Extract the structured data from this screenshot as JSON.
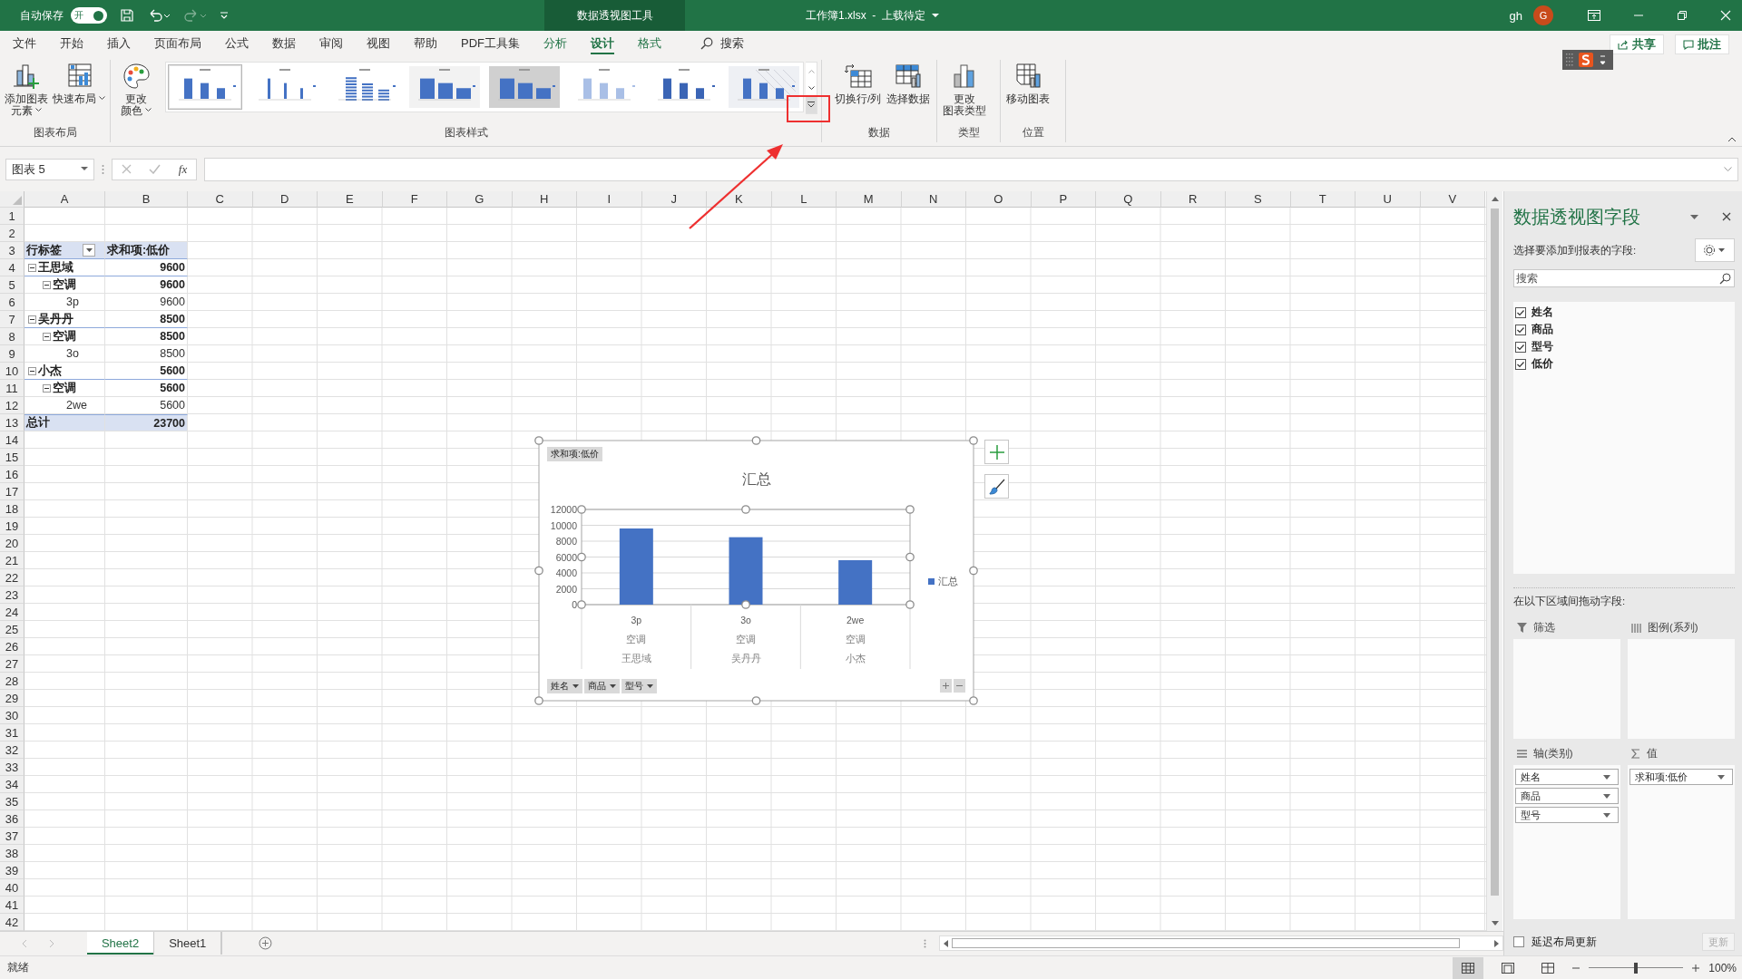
{
  "title_bar": {
    "autosave_label": "自动保存",
    "autosave_toggle": {
      "label": "开",
      "on": true
    },
    "context_tab": "数据透视图工具",
    "document_title": "工作簿1.xlsx  -  上载待定",
    "user": "gh",
    "avatar_initial": "G"
  },
  "menu_tabs": [
    {
      "label": "文件",
      "selected": false,
      "contextual": false
    },
    {
      "label": "开始",
      "selected": false,
      "contextual": false
    },
    {
      "label": "插入",
      "selected": false,
      "contextual": false
    },
    {
      "label": "页面布局",
      "selected": false,
      "contextual": false
    },
    {
      "label": "公式",
      "selected": false,
      "contextual": false
    },
    {
      "label": "数据",
      "selected": false,
      "contextual": false
    },
    {
      "label": "审阅",
      "selected": false,
      "contextual": false
    },
    {
      "label": "视图",
      "selected": false,
      "contextual": false
    },
    {
      "label": "帮助",
      "selected": false,
      "contextual": false
    },
    {
      "label": "PDF工具集",
      "selected": false,
      "contextual": false
    },
    {
      "label": "分析",
      "selected": false,
      "contextual": true
    },
    {
      "label": "设计",
      "selected": true,
      "contextual": true
    },
    {
      "label": "格式",
      "selected": false,
      "contextual": true
    }
  ],
  "search_label": "搜索",
  "share_button": "共享",
  "comment_button": "批注",
  "ribbon": {
    "groups": [
      {
        "label": "图表布局",
        "buttons": [
          {
            "lines": [
              "添加图表",
              "元素"
            ],
            "dropdown": true
          },
          {
            "lines": [
              "快速布局"
            ],
            "dropdown": true
          }
        ]
      },
      {
        "label": "图表样式",
        "buttons": [
          {
            "lines": [
              "更改",
              "颜色"
            ],
            "dropdown": true
          }
        ],
        "styles": [
          {
            "selected": true
          },
          {
            "selected": false
          },
          {
            "selected": false
          },
          {
            "selected": false
          },
          {
            "selected": false
          },
          {
            "selected": false
          },
          {
            "selected": false
          },
          {
            "selected": false
          }
        ]
      },
      {
        "label": "数据",
        "buttons": [
          {
            "lines": [
              "切换行/列"
            ],
            "dropdown": false
          },
          {
            "lines": [
              "选择数据"
            ],
            "dropdown": false
          }
        ]
      },
      {
        "label": "类型",
        "buttons": [
          {
            "lines": [
              "更改",
              "图表类型"
            ],
            "dropdown": false
          }
        ]
      },
      {
        "label": "位置",
        "buttons": [
          {
            "lines": [
              "移动图表"
            ],
            "dropdown": false
          }
        ]
      }
    ]
  },
  "formula_bar": {
    "name_box": "图表 5",
    "fx": "fx"
  },
  "columns": [
    "A",
    "B",
    "C",
    "D",
    "E",
    "F",
    "G",
    "H",
    "I",
    "J",
    "K",
    "L",
    "M",
    "N",
    "O",
    "P",
    "Q",
    "R",
    "S",
    "T",
    "U",
    "V"
  ],
  "row_numbers": [
    "1",
    "2",
    "3",
    "4",
    "5",
    "6",
    "7",
    "8",
    "9",
    "10",
    "11",
    "12",
    "13",
    "14",
    "15",
    "16",
    "17",
    "18",
    "19",
    "20",
    "21",
    "22",
    "23",
    "24",
    "25",
    "26",
    "27",
    "28",
    "29",
    "30",
    "31",
    "32",
    "33",
    "34",
    "35",
    "36",
    "37",
    "38",
    "39",
    "40",
    "41",
    "42"
  ],
  "pivot": {
    "row_label_header": "行标签",
    "value_header": "求和项:低价",
    "rows": [
      {
        "label": "王思域",
        "value": "9600",
        "expanded": true,
        "children": [
          {
            "label": "空调",
            "value": "9600",
            "expanded": true,
            "children": [
              {
                "label": "3p",
                "value": "9600"
              }
            ]
          }
        ]
      },
      {
        "label": "吴丹丹",
        "value": "8500",
        "expanded": true,
        "children": [
          {
            "label": "空调",
            "value": "8500",
            "expanded": true,
            "children": [
              {
                "label": "3o",
                "value": "8500"
              }
            ]
          }
        ]
      },
      {
        "label": "小杰",
        "value": "5600",
        "expanded": true,
        "children": [
          {
            "label": "空调",
            "value": "5600",
            "expanded": true,
            "children": [
              {
                "label": "2we",
                "value": "5600"
              }
            ]
          }
        ]
      }
    ],
    "total": {
      "label": "总计",
      "value": "23700"
    }
  },
  "pivot_chart": {
    "value_field_button": "求和项:低价",
    "axis_field_buttons": [
      "姓名",
      "商品",
      "型号"
    ],
    "category_groups": [
      [
        "空调",
        "空调",
        "空调"
      ],
      [
        "王思域",
        "吴丹丹",
        "小杰"
      ]
    ],
    "chart_data": {
      "type": "bar",
      "title": "汇总",
      "categories": [
        "3p",
        "3o",
        "2we"
      ],
      "series": [
        {
          "name": "汇总",
          "color": "#4472c4",
          "values": [
            9600,
            8500,
            5600
          ]
        }
      ],
      "ylim": [
        0,
        12000
      ],
      "yticks": [
        0,
        2000,
        4000,
        6000,
        8000,
        10000,
        12000
      ],
      "grid": true
    }
  },
  "field_pane": {
    "title": "数据透视图字段",
    "subtitle": "选择要添加到报表的字段:",
    "search_placeholder": "搜索",
    "fields": [
      {
        "label": "姓名",
        "checked": true
      },
      {
        "label": "商品",
        "checked": true
      },
      {
        "label": "型号",
        "checked": true
      },
      {
        "label": "低价",
        "checked": true
      }
    ],
    "drag_label": "在以下区域间拖动字段:",
    "areas": [
      {
        "label": "筛选"
      },
      {
        "label": "图例(系列)"
      },
      {
        "label": "轴(类别)",
        "items": [
          "姓名",
          "商品",
          "型号"
        ]
      },
      {
        "label": "值",
        "items": [
          "求和项:低价"
        ]
      }
    ],
    "defer_update": {
      "label": "延迟布局更新",
      "checked": false
    },
    "update_button": {
      "label": "更新",
      "disabled": true
    }
  },
  "sheet_tabs": [
    {
      "label": "Sheet2",
      "selected": true
    },
    {
      "label": "Sheet1",
      "selected": false
    }
  ],
  "status_bar": {
    "text": "就绪",
    "views": [
      {
        "selected": true
      },
      {
        "selected": false
      },
      {
        "selected": false
      }
    ],
    "zoom": {
      "level": 0.5,
      "reading": "100%"
    }
  }
}
